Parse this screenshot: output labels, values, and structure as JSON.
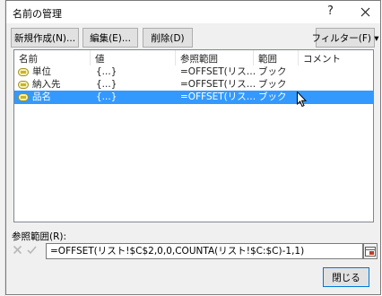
{
  "dialog": {
    "title": "名前の管理",
    "help_glyph": "?"
  },
  "toolbar": {
    "new_label": "新規作成(N)...",
    "edit_label": "編集(E)...",
    "delete_label": "削除(D)",
    "filter_label": "フィルター(F) ▾"
  },
  "list": {
    "columns": [
      "名前",
      "値",
      "参照範囲",
      "範囲",
      "コメント"
    ],
    "rows": [
      {
        "name": "単位",
        "value": "{...}",
        "refers_to": "=OFFSET(リス…",
        "scope": "ブック",
        "comment": "",
        "selected": false
      },
      {
        "name": "納入先",
        "value": "{...}",
        "refers_to": "=OFFSET(リス…",
        "scope": "ブック",
        "comment": "",
        "selected": false
      },
      {
        "name": "品名",
        "value": "{...}",
        "refers_to": "=OFFSET(リス…",
        "scope": "ブック",
        "comment": "",
        "selected": true
      }
    ]
  },
  "reference": {
    "label": "参照範囲(R):",
    "value": "=OFFSET(リスト!$C$2,0,0,COUNTA(リスト!$C:$C)-1,1)"
  },
  "footer": {
    "close_label": "閉じる"
  },
  "colors": {
    "selection": "#3399ff",
    "dialog_bg": "#f0f0f0"
  }
}
